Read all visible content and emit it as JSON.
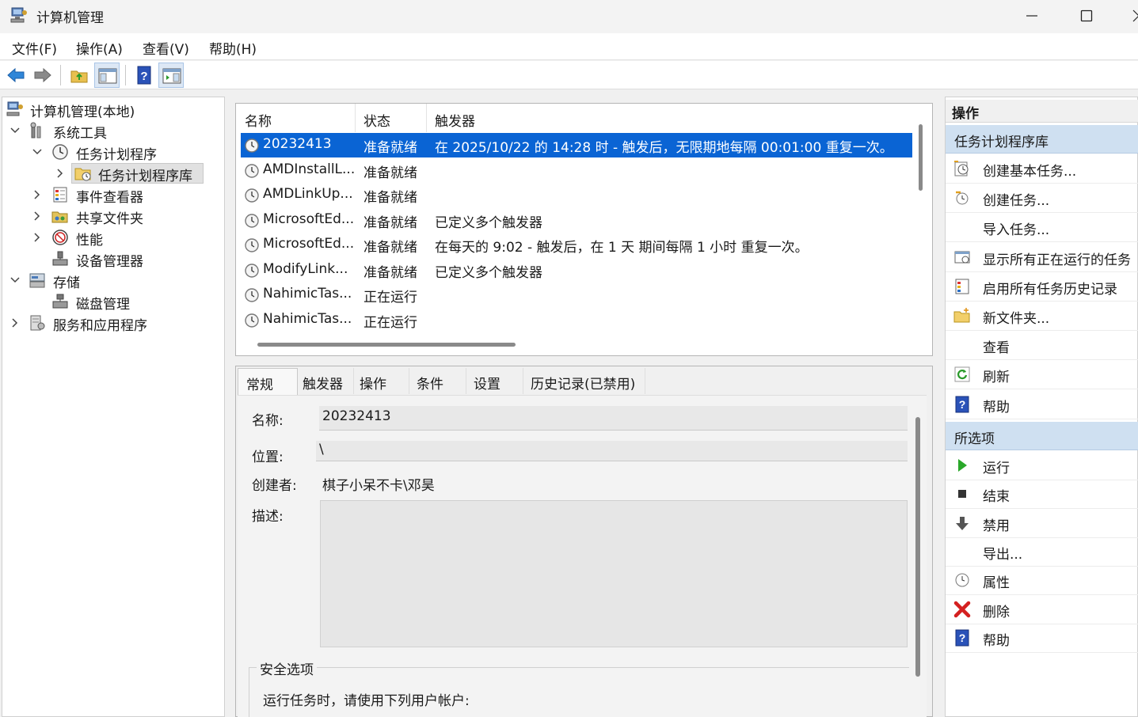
{
  "window": {
    "title": "计算机管理"
  },
  "menu": [
    "文件(F)",
    "操作(A)",
    "查看(V)",
    "帮助(H)"
  ],
  "tree": {
    "root": "计算机管理(本地)",
    "system_tools": "系统工具",
    "task_scheduler": "任务计划程序",
    "task_library": "任务计划程序库",
    "event_viewer": "事件查看器",
    "shared_folders": "共享文件夹",
    "performance": "性能",
    "device_manager": "设备管理器",
    "storage": "存储",
    "disk_management": "磁盘管理",
    "services_apps": "服务和应用程序"
  },
  "task_list": {
    "headers": {
      "name": "名称",
      "status": "状态",
      "trigger": "触发器"
    },
    "rows": [
      {
        "name": "20232413",
        "status": "准备就绪",
        "trigger": "在 2025/10/22 的 14:28 时 - 触发后，无限期地每隔 00:01:00 重复一次。"
      },
      {
        "name": "AMDInstallL...",
        "status": "准备就绪",
        "trigger": ""
      },
      {
        "name": "AMDLinkUp...",
        "status": "准备就绪",
        "trigger": ""
      },
      {
        "name": "MicrosoftEd...",
        "status": "准备就绪",
        "trigger": "已定义多个触发器"
      },
      {
        "name": "MicrosoftEd...",
        "status": "准备就绪",
        "trigger": "在每天的 9:02 - 触发后，在 1 天 期间每隔 1 小时 重复一次。"
      },
      {
        "name": "ModifyLink...",
        "status": "准备就绪",
        "trigger": "已定义多个触发器"
      },
      {
        "name": "NahimicTas...",
        "status": "正在运行",
        "trigger": ""
      },
      {
        "name": "NahimicTas...",
        "status": "正在运行",
        "trigger": ""
      }
    ]
  },
  "tabs": [
    "常规",
    "触发器",
    "操作",
    "条件",
    "设置",
    "历史记录(已禁用)"
  ],
  "general": {
    "name_label": "名称:",
    "name_value": "20232413",
    "location_label": "位置:",
    "location_value": "\\",
    "author_label": "创建者:",
    "author_value": "棋子小呆不卡\\邓昊",
    "description_label": "描述:",
    "security_legend": "安全选项",
    "security_text": "运行任务时，请使用下列用户帐户:"
  },
  "actions": {
    "header": "操作",
    "section1": "任务计划程序库",
    "items1": [
      "创建基本任务...",
      "创建任务...",
      "导入任务...",
      "显示所有正在运行的任务",
      "启用所有任务历史记录",
      "新文件夹...",
      "查看",
      "刷新",
      "帮助"
    ],
    "section2": "所选项",
    "items2": [
      "运行",
      "结束",
      "禁用",
      "导出...",
      "属性",
      "删除",
      "帮助"
    ]
  }
}
